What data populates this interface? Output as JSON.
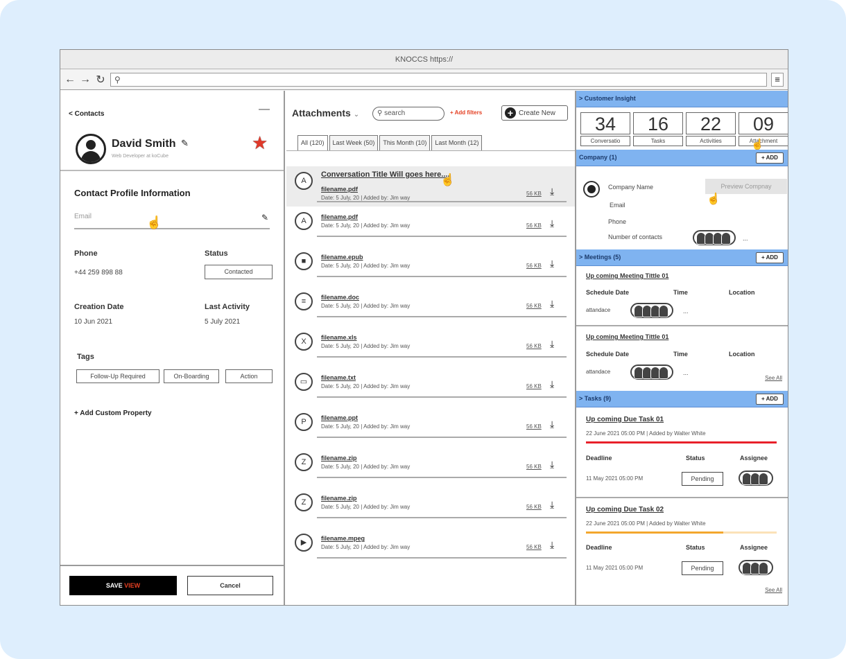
{
  "browser": {
    "title": "KNOCCS https://",
    "back_icon": "back-arrow-icon",
    "forward_icon": "forward-arrow-icon",
    "reload_icon": "reload-icon",
    "menu_icon": "hamburger-menu-icon"
  },
  "contact": {
    "back_label": "< Contacts",
    "name": "David Smith",
    "role": "Web Developer at koCube",
    "section_title": "Contact Profile Information",
    "email_label": "Email",
    "phone_label": "Phone",
    "phone_value": "+44 259 898 88",
    "status_label": "Status",
    "status_value": "Contacted",
    "creation_label": "Creation Date",
    "creation_value": "10 Jun 2021",
    "activity_label": "Last Activity",
    "activity_value": "5 July 2021",
    "tags_label": "Tags",
    "tags": [
      "Follow-Up Required",
      "On-Boarding",
      "Action"
    ],
    "add_property": "+ Add Custom Property",
    "save_label": "SAVE",
    "save_accent": "VIEW",
    "cancel_label": "Cancel"
  },
  "attachments": {
    "title": "Attachments",
    "search_placeholder": "search",
    "add_filters": "+ Add filters",
    "create_new": "Create New",
    "tabs": [
      "All (120)",
      "Last Week (50)",
      "This Month (10)",
      "Last Month (12)"
    ],
    "conversation_title": "Conversation Title Will goes here....",
    "items": [
      {
        "name": "filename.pdf",
        "meta": "Date: 5 July, 20  |  Added by: Jim way",
        "size": "56 KB",
        "icon": "pdf-file-icon",
        "glyph": "A"
      },
      {
        "name": "filename.pdf",
        "meta": "Date: 5 July, 20  |  Added by: Jim way",
        "size": "56 KB",
        "icon": "pdf-file-icon",
        "glyph": "A"
      },
      {
        "name": "filename.epub",
        "meta": "Date: 5 July, 20  |  Added by: Jim way",
        "size": "56 KB",
        "icon": "epub-file-icon",
        "glyph": "■"
      },
      {
        "name": "filename.doc",
        "meta": "Date: 5 July, 20  |  Added by: Jim way",
        "size": "56 KB",
        "icon": "doc-file-icon",
        "glyph": "≡"
      },
      {
        "name": "filename.xls",
        "meta": "Date: 5 July, 20  |  Added by: Jim way",
        "size": "56 KB",
        "icon": "xls-file-icon",
        "glyph": "X"
      },
      {
        "name": "filename.txt",
        "meta": "Date: 5 July, 20  |  Added by: Jim way",
        "size": "56 KB",
        "icon": "txt-file-icon",
        "glyph": "▭"
      },
      {
        "name": "filename.ppt",
        "meta": "Date: 5 July, 20  |  Added by: Jim way",
        "size": "56 KB",
        "icon": "ppt-file-icon",
        "glyph": "P"
      },
      {
        "name": "filename.zip",
        "meta": "Date: 5 July, 20  |  Added by: Jim way",
        "size": "56 KB",
        "icon": "zip-file-icon",
        "glyph": "Z"
      },
      {
        "name": "filename.zip",
        "meta": "Date: 5 July, 20  |  Added by: Jim way",
        "size": "56 KB",
        "icon": "zip-file-icon",
        "glyph": "Z"
      },
      {
        "name": "filename.mpeg",
        "meta": "Date: 5 July, 20  |  Added by: Jim way",
        "size": "56 KB",
        "icon": "video-file-icon",
        "glyph": "▶"
      }
    ]
  },
  "insight": {
    "header": "> Customer Insight",
    "stats": [
      {
        "num": "34",
        "label": "Conversatio"
      },
      {
        "num": "16",
        "label": "Tasks"
      },
      {
        "num": "22",
        "label": "Activities"
      },
      {
        "num": "09",
        "label": "Attachment"
      }
    ],
    "company_header": "Company (1)",
    "add_label": "+ ADD",
    "company_name": "Company Name",
    "preview_company": "Preview Compnay",
    "email": "Email",
    "phone": "Phone",
    "contacts_label": "Number of contacts",
    "more": "...",
    "meetings_header": "> Meetings (5)",
    "meetings": [
      {
        "title": "Up coming Meeting Tittle 01",
        "schedule": "Schedule Date",
        "time": "Time",
        "location": "Location",
        "attendance": "attandace"
      },
      {
        "title": "Up coming Meeting Tittle 01",
        "schedule": "Schedule Date",
        "time": "Time",
        "location": "Location",
        "attendance": "attandace"
      }
    ],
    "see_all": "See All",
    "tasks_header": "> Tasks (9)",
    "tasks": [
      {
        "title": "Up coming Due Task 01",
        "meta": "22 June 2021 05:00 PM | Added by Walter White",
        "deadline_label": "Deadline",
        "deadline": "11 May 2021 05:00 PM",
        "status_label": "Status",
        "status": "Pending",
        "assignee_label": "Assignee",
        "progress": 1.0,
        "color": "#e8202a"
      },
      {
        "title": "Up coming Due Task 02",
        "meta": "22 June 2021 05:00 PM | Added by Walter White",
        "deadline_label": "Deadline",
        "deadline": "11 May 2021 05:00 PM",
        "status_label": "Status",
        "status": "Pending",
        "assignee_label": "Assignee",
        "progress": 0.72,
        "color": "#f3a72d"
      }
    ]
  }
}
